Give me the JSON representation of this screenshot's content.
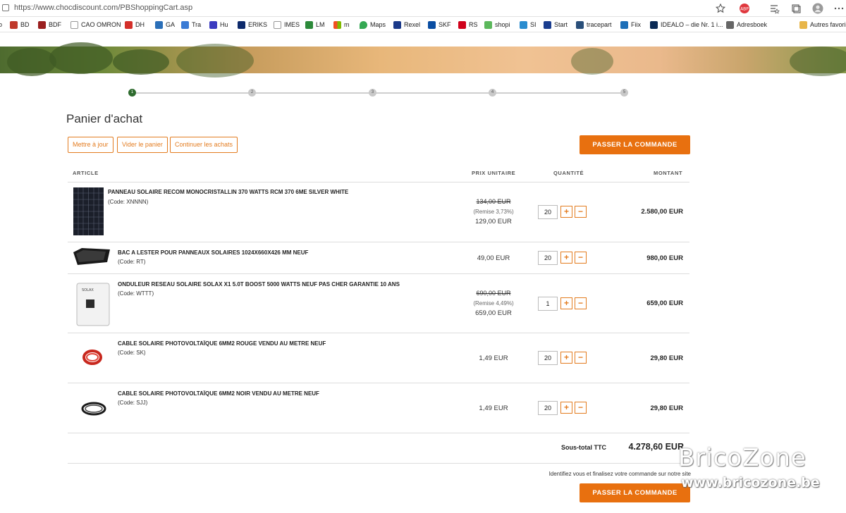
{
  "browser": {
    "url_prefix": "https://www.chocdiscount.com",
    "url_path": "/PBShoppingCart.asp",
    "bookmarks": [
      {
        "label": "BD",
        "color": "#c0392b"
      },
      {
        "label": "BDF",
        "color": "#9a1f1f"
      },
      {
        "label": "CAO OMRON",
        "color": "#777777"
      },
      {
        "label": "DH",
        "color": "#d4302a"
      },
      {
        "label": "GA",
        "color": "#2b6fb8"
      },
      {
        "label": "Tra",
        "color": "#3a7bd5"
      },
      {
        "label": "Hu",
        "color": "#3b3bc0"
      },
      {
        "label": "ERIKS",
        "color": "#0d2a6b"
      },
      {
        "label": "IMES",
        "color": "#555555"
      },
      {
        "label": "LM",
        "color": "#2c8a3a"
      },
      {
        "label": "m",
        "color": "#f25022"
      },
      {
        "label": "Maps",
        "color": "#34a853"
      },
      {
        "label": "Rexel",
        "color": "#1b3a8a"
      },
      {
        "label": "SKF",
        "color": "#0a4da2"
      },
      {
        "label": "RS",
        "color": "#d0021b"
      },
      {
        "label": "shopi",
        "color": "#5cb85c"
      },
      {
        "label": "SI",
        "color": "#2a8ccf"
      },
      {
        "label": "Start",
        "color": "#1a3d8f"
      },
      {
        "label": "tracepart",
        "color": "#2a4f7a"
      },
      {
        "label": "Fiix",
        "color": "#1d6fb8"
      },
      {
        "label": "IDEALO – die Nr. 1 i...",
        "color": "#0a2a55"
      },
      {
        "label": "Adresboek",
        "color": "#666666"
      }
    ],
    "other_favorites": "Autres favoris"
  },
  "checkout": {
    "steps": [
      "1",
      "2",
      "3",
      "4",
      "5"
    ],
    "active_step": 1
  },
  "cart": {
    "title": "Panier d'achat",
    "buttons": {
      "update": "Mettre à jour",
      "empty": "Vider le panier",
      "continue": "Continuer les achats",
      "checkout": "PASSER LA COMMANDE"
    },
    "headers": {
      "article": "ARTICLE",
      "unit_price": "PRIX UNITAIRE",
      "quantity": "QUANTITÉ",
      "amount": "MONTANT"
    },
    "items": [
      {
        "name": "PANNEAU SOLAIRE RECOM MONOCRISTALLIN 370 WATTS RCM 370 6ME SILVER WHITE",
        "code": "(Code: XNNNN)",
        "old_price": "134,00 EUR",
        "discount": "(Remise 3,73%)",
        "price": "129,00 EUR",
        "qty": "20",
        "amount": "2.580,00 EUR",
        "image": "solar-panel"
      },
      {
        "name": "BAC A LESTER POUR PANNEAUX SOLAIRES 1024X660X426 MM NEUF",
        "code": "(Code: RT)",
        "price": "49,00 EUR",
        "qty": "20",
        "amount": "980,00 EUR",
        "image": "ballast-tray"
      },
      {
        "name": "ONDULEUR RESEAU SOLAIRE SOLAX X1 5.0T BOOST 5000 WATTS NEUF PAS CHER GARANTIE 10 ANS",
        "code": "(Code: WTTT)",
        "old_price": "690,00 EUR",
        "discount": "(Remise 4,49%)",
        "price": "659,00 EUR",
        "qty": "1",
        "amount": "659,00 EUR",
        "image": "inverter"
      },
      {
        "name": "CABLE SOLAIRE PHOTOVOLTAÏQUE 6MM2 ROUGE VENDU AU METRE NEUF",
        "code": "(Code: SK)",
        "price": "1,49 EUR",
        "qty": "20",
        "amount": "29,80 EUR",
        "image": "red-cable"
      },
      {
        "name": "CABLE SOLAIRE PHOTOVOLTAÏQUE 6MM2 NOIR VENDU AU METRE NEUF",
        "code": "(Code: SJJ)",
        "price": "1,49 EUR",
        "qty": "20",
        "amount": "29,80 EUR",
        "image": "black-cable"
      }
    ],
    "subtotal_label": "Sous-total TTC",
    "subtotal_value": "4.278,60 EUR",
    "identify_text": "Identifiez vous et finalisez votre commande sur notre site"
  },
  "watermark": {
    "line1": "BricoZone",
    "line2": "www.bricozone.be"
  },
  "colors": {
    "accent": "#e8700f",
    "active_step": "#2e6b2e"
  }
}
